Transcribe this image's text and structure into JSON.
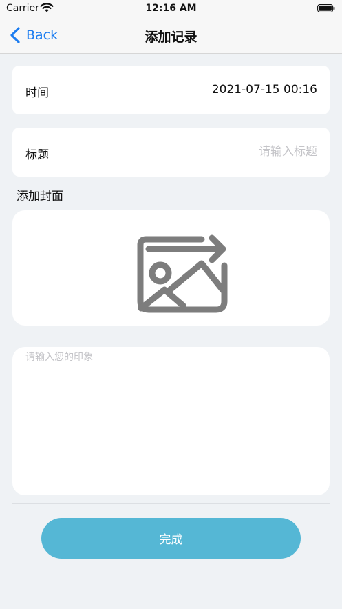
{
  "status_bar": {
    "carrier": "Carrier",
    "time": "12:16 AM"
  },
  "nav": {
    "back_label": "Back",
    "title": "添加记录"
  },
  "form": {
    "time_label": "时间",
    "time_value": "2021-07-15 00:16",
    "title_label": "标题",
    "title_placeholder": "请输入标题",
    "title_value": "",
    "cover_label": "添加封面",
    "notes_placeholder": "请输入您的印象",
    "notes_value": ""
  },
  "actions": {
    "done_label": "完成"
  },
  "colors": {
    "accent_blue": "#1b7cf0",
    "button": "#55b7d5",
    "background": "#eff2f5",
    "placeholder": "#c4c4c8"
  },
  "icons": {
    "cover": "image-upload-icon",
    "back": "chevron-left-icon"
  }
}
